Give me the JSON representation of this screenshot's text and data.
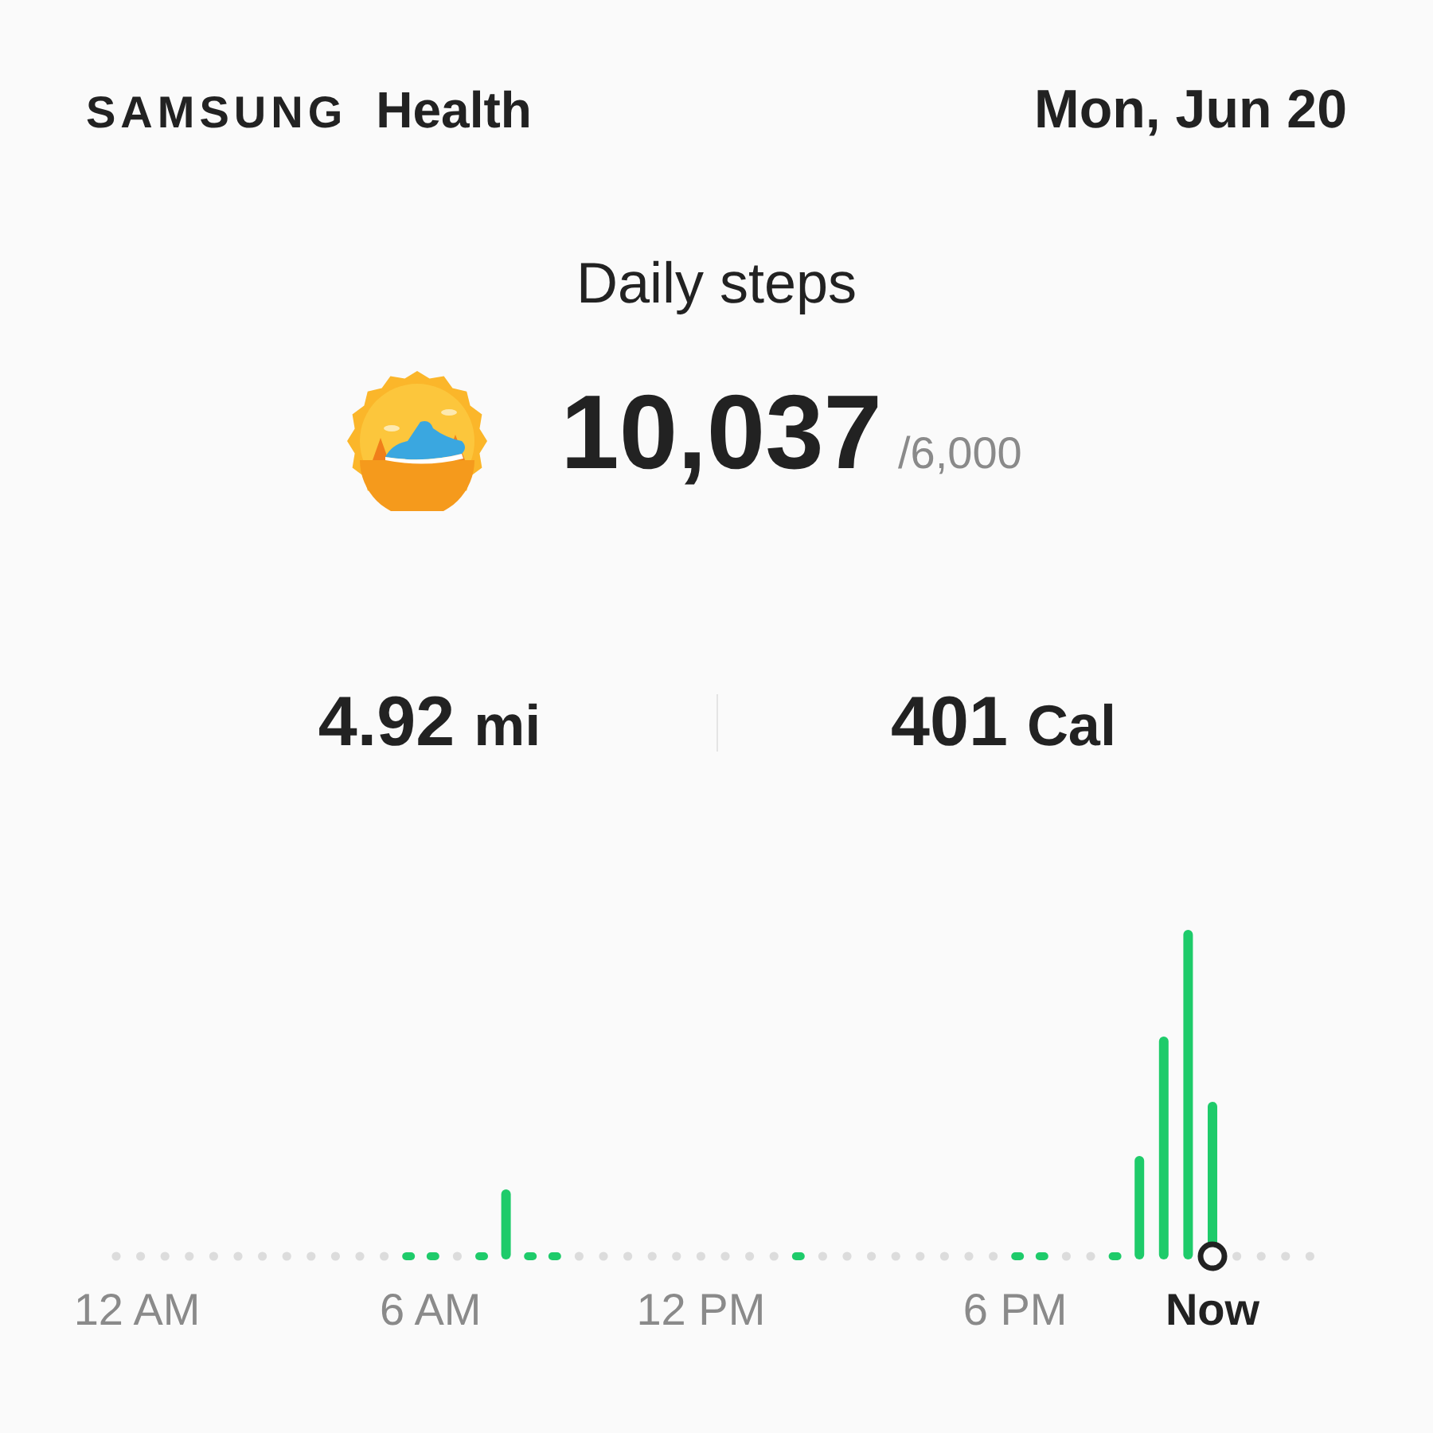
{
  "header": {
    "brand": "SAMSUNG",
    "app": "Health",
    "date": "Mon, Jun 20"
  },
  "steps": {
    "title": "Daily steps",
    "count": "10,037",
    "goal": "/6,000"
  },
  "stats": [
    {
      "value": "4.92",
      "unit": "mi"
    },
    {
      "value": "401",
      "unit": "Cal"
    }
  ],
  "time_labels": [
    {
      "label": "12 AM",
      "kind": "tick"
    },
    {
      "label": "6 AM",
      "kind": "tick"
    },
    {
      "label": "12 PM",
      "kind": "tick"
    },
    {
      "label": "6 PM",
      "kind": "tick"
    },
    {
      "label": "Now",
      "kind": "now"
    }
  ]
}
